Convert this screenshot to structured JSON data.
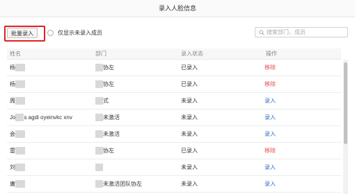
{
  "dialog": {
    "title": "录入人脸信息",
    "batch_button": "批量录入",
    "only_unregistered_label": "仅显示未录入成员",
    "search_placeholder": "搜索部门、成员"
  },
  "table": {
    "headers": [
      "姓名",
      "部门",
      "录入状态",
      "操作"
    ],
    "rows": [
      {
        "name": "杨",
        "dept": "协左",
        "status": "已录入",
        "action": "移除",
        "action_type": "remove"
      },
      {
        "name": "杨",
        "dept": "协左",
        "status": "已录入",
        "action": "移除",
        "action_type": "remove"
      },
      {
        "name": "周",
        "dept": "式",
        "status": "未录入",
        "action": "录入",
        "action_type": "enter"
      },
      {
        "name": "Jo",
        "name_tail": "s agdi oyeinvkc xnv",
        "dept": "未激活",
        "status": "未录入",
        "action": "录入",
        "action_type": "enter"
      },
      {
        "name": "会",
        "dept": "未激活",
        "status": "未录入",
        "action": "录入",
        "action_type": "enter"
      },
      {
        "name": "雷",
        "dept": "协左",
        "status": "已录入",
        "action": "移除",
        "action_type": "remove"
      },
      {
        "name": "刘",
        "dept": "",
        "status": "未录入",
        "action": "录入",
        "action_type": "enter"
      },
      {
        "name": "庸",
        "dept": "未激活团队协左",
        "status": "未录入",
        "action": "录入",
        "action_type": "enter"
      }
    ]
  },
  "colors": {
    "remove": "#e84a4a",
    "enter": "#2f6fbf",
    "highlight": "#e02020"
  }
}
